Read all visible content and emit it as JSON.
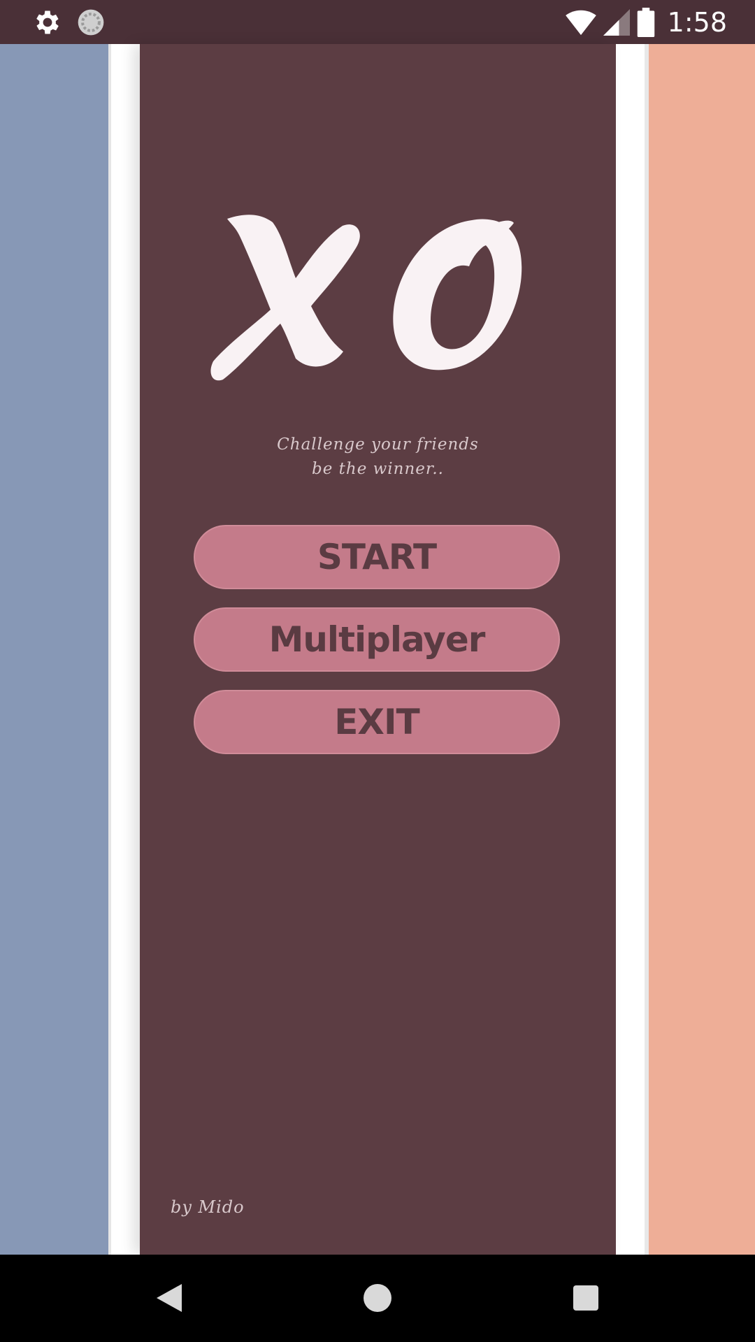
{
  "status_bar": {
    "time": "1:58",
    "icons": [
      "settings-gear-icon",
      "loading-circle-icon",
      "wifi-icon",
      "cell-signal-icon",
      "battery-icon"
    ]
  },
  "app": {
    "logo": {
      "text": "XO",
      "color": "#f9f2f4"
    },
    "tagline": {
      "line1": "Challenge your friends",
      "line2": "be the winner.."
    },
    "buttons": {
      "start": "START",
      "multiplayer": "Multiplayer",
      "exit": "EXIT"
    },
    "credit": "by Mido",
    "colors": {
      "panel": "#5c3d43",
      "button": "#c47b8a",
      "button_text": "#5a3b42",
      "left_stripe": "#8798b6",
      "right_stripe": "#eeae97"
    }
  },
  "nav_bar": {
    "icons": [
      "back-triangle-icon",
      "home-circle-icon",
      "recents-square-icon"
    ]
  }
}
